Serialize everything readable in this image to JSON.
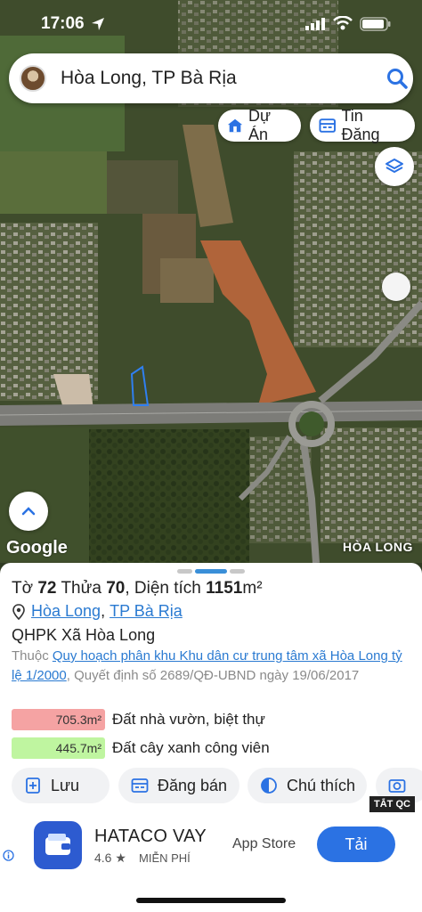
{
  "status_bar": {
    "time": "17:06"
  },
  "search": {
    "query": "Hòa Long, TP Bà Rịa"
  },
  "chips": {
    "du_an": "Dự Án",
    "tin_dang": "Tin Đăng"
  },
  "map": {
    "attribution": "Google",
    "place_label": "HÒA LONG"
  },
  "parcel": {
    "prefix_to": "Tờ",
    "to_number": "72",
    "prefix_thua": "Thửa",
    "thua_number": "70",
    "area_label": "Diện tích",
    "area_value": "1151",
    "area_unit": "m²"
  },
  "address": {
    "ward": "Hòa Long",
    "separator": ",",
    "city": "TP Bà Rịa"
  },
  "zone_title": "QHPK Xã Hòa Long",
  "description": {
    "prefix": "Thuộc ",
    "plan_link": "Quy hoạch phân khu Khu dân cư trung tâm xã Hòa Long tỷ lệ 1/2000",
    "suffix": ", Quyết định số 2689/QĐ-UBND ngày 19/06/2017"
  },
  "land_use": [
    {
      "area": "705.3m²",
      "label": "Đất nhà vườn, biệt thự",
      "color": "#f5a3a3"
    },
    {
      "area": "445.7m²",
      "label": "Đất cây xanh công viên",
      "color": "#bff5a0"
    }
  ],
  "actions": {
    "save": "Lưu",
    "post": "Đăng bán",
    "legend": "Chú thích"
  },
  "ad_close_label": "TẮT QC",
  "ad": {
    "app_name": "HATACO VAY",
    "rating": "4.6 ★",
    "price": "MIỄN PHÍ",
    "store": "App Store",
    "install": "Tải"
  },
  "colors": {
    "accent": "#2b72e3",
    "link": "#2a7ad1"
  }
}
